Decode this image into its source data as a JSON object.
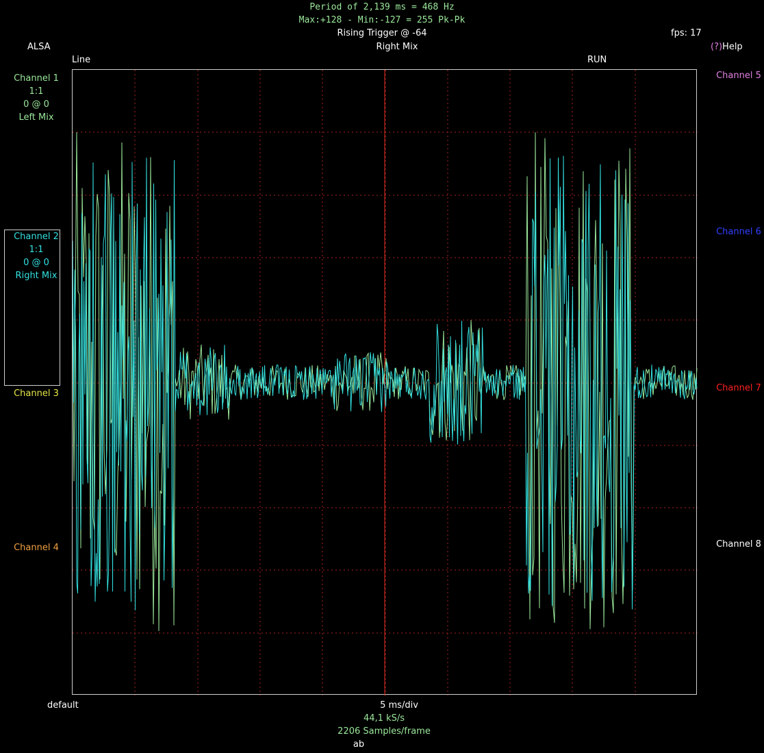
{
  "header": {
    "period_line": "Period of 2,139 ms =   468 Hz",
    "maxmin_line": "Max:+128 - Min:-127 = 255 Pk-Pk",
    "trigger": "Rising Trigger @ -64",
    "fps": "fps: 17",
    "source": "ALSA",
    "mix": "Right Mix",
    "help_prefix": "(?)",
    "help_label": "Help",
    "input": "Line",
    "run_state": "RUN"
  },
  "channels_left": [
    {
      "name": "Channel 1",
      "scale": "1:1",
      "offset": "0 @ 0",
      "source": "Left Mix",
      "color": "#9be89b"
    },
    {
      "name": "Channel 2",
      "scale": "1:1",
      "offset": "0 @ 0",
      "source": "Right Mix",
      "color": "#33e0e0"
    },
    {
      "name": "Channel 3",
      "color": "#e6e64a"
    },
    {
      "name": "Channel 4",
      "color": "#f0a040"
    }
  ],
  "channels_right": [
    {
      "name": "Channel 5",
      "color": "#e080e0"
    },
    {
      "name": "Channel 6",
      "color": "#3040ff"
    },
    {
      "name": "Channel 7",
      "color": "#ff2020"
    },
    {
      "name": "Channel 8",
      "color": "#ffffff"
    }
  ],
  "footer": {
    "device": "default",
    "timebase": "5 ms/div",
    "samplerate": "44,1 kS/s",
    "samples": "2206 Samples/frame",
    "mode": "ab"
  },
  "colors": {
    "grid": "#b02020",
    "trigger_line": "#e03020",
    "frame": "#cfcfcf"
  }
}
